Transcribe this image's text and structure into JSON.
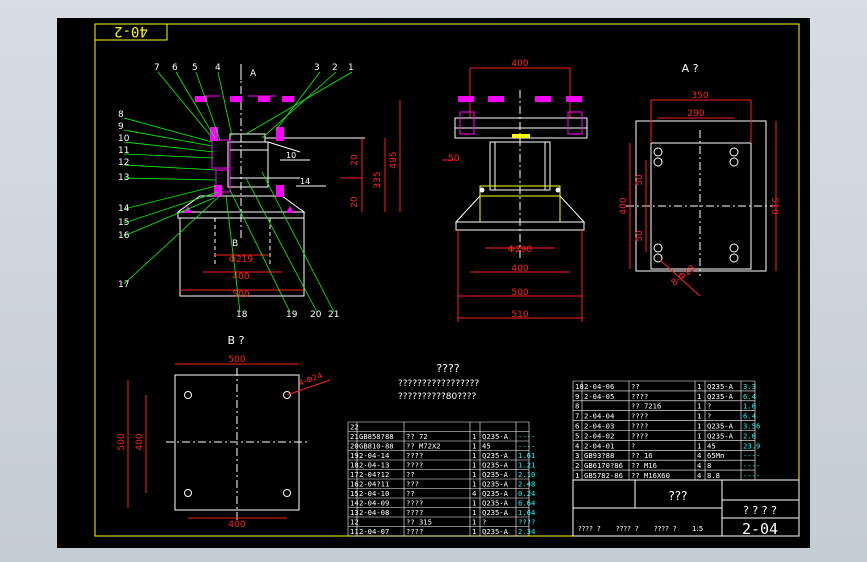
{
  "sheet": {
    "code_box": "40-2",
    "drawing_number": "2-04",
    "title_center": "???",
    "title_right": "? ? ? ?",
    "notes_title": "????",
    "notes": [
      "?????????????????",
      "??????????80????"
    ]
  },
  "front_view": {
    "section_label_top": "A",
    "section_label_bottom": "B",
    "part_numbers_top": [
      "7",
      "6",
      "5",
      "4",
      "3",
      "2",
      "1"
    ],
    "part_numbers_left": [
      "8",
      "9",
      "10",
      "11",
      "12",
      "13",
      "14",
      "15",
      "16",
      "17"
    ],
    "part_numbers_bottom": [
      "18",
      "19",
      "20",
      "21"
    ],
    "angle_labels": [
      "10",
      "14"
    ],
    "dims": {
      "d20a": "20",
      "d335": "335",
      "d495": "495",
      "d20b": "20",
      "phi219": "Φ219",
      "w400": "400",
      "w500": "500"
    }
  },
  "side_view": {
    "dims": {
      "top": "400",
      "left50": "50",
      "phi290": "Φ290",
      "w400": "400",
      "w500": "500",
      "w510": "510"
    }
  },
  "view_a": {
    "title": "A  ?",
    "dims": {
      "w350": "350",
      "w290": "290",
      "h400": "400",
      "h510": "510",
      "v50a": "50",
      "v50b": "50",
      "holes": "8-Φ18"
    }
  },
  "view_b": {
    "title": "B  ?",
    "dims": {
      "w500": "500",
      "h500": "500",
      "h400": "400",
      "w400": "400",
      "holes": "4-Φ24"
    }
  },
  "bom_left": {
    "rows": [
      [
        "22",
        "",
        "",
        "",
        "",
        ""
      ],
      [
        "21",
        "GB858?88",
        "??  72",
        "1",
        "Q235-A",
        "----"
      ],
      [
        "20",
        "GB810-88",
        "?? M72X2",
        "1",
        "45",
        "----"
      ],
      [
        "19",
        "2-04-14",
        "????",
        "1",
        "Q235-A",
        "1.61"
      ],
      [
        "18",
        "2-04-13",
        "????",
        "1",
        "Q235-A",
        "1.21"
      ],
      [
        "17",
        "2-04?12",
        "??",
        "1",
        "Q235-A",
        "2.10"
      ],
      [
        "16",
        "2-04?11",
        "???",
        "1",
        "Q235-A",
        "2.48"
      ],
      [
        "15",
        "2-04-10",
        "??",
        "4",
        "Q235-A",
        "0.24"
      ],
      [
        "14",
        "2-04-09",
        "????",
        "1",
        "Q235-A",
        "6.64"
      ],
      [
        "13",
        "2-04-08",
        "????",
        "1",
        "Q235-A",
        "1.64"
      ],
      [
        "12",
        "",
        "?? 315",
        "1",
        "?",
        "????"
      ],
      [
        "11",
        "2-04-07",
        "????",
        "1",
        "Q235-A",
        "2.34"
      ]
    ]
  },
  "bom_right": {
    "rows": [
      [
        "10",
        "2-04-06",
        "??",
        "1",
        "Q235-A",
        "3.3"
      ],
      [
        "9",
        "2-04-05",
        "????",
        "1",
        "Q235-A",
        "6.4"
      ],
      [
        "8",
        "",
        "?? 7216",
        "1",
        "?",
        "1.6"
      ],
      [
        "7",
        "2-04-04",
        "????",
        "1",
        "?",
        "6.4"
      ],
      [
        "6",
        "2-04-03",
        "????",
        "1",
        "Q235-A",
        "3.56"
      ],
      [
        "5",
        "2-04-02",
        "????",
        "1",
        "Q235-A",
        "2.6"
      ],
      [
        "4",
        "2-04-01",
        "?",
        "1",
        "45",
        "23.9"
      ],
      [
        "3",
        "GB93?88",
        "?? 16",
        "4",
        "65Mn",
        "----"
      ],
      [
        "2",
        "GB6170?86",
        "?? M16",
        "4",
        "8",
        "----"
      ],
      [
        "1",
        "GB5782-86",
        "?? M16X60",
        "4",
        "8.8",
        "----"
      ]
    ],
    "footer": [
      "????",
      "?",
      "????",
      "?",
      "????",
      "?",
      "1:5"
    ]
  },
  "colors": {
    "background": "#000000",
    "frame": "#ffff00",
    "lines": "#ffffff",
    "dims": "#ff2020",
    "bolts": "#ff00ff",
    "leaders": "#00ff00",
    "cyan": "#00ffff"
  }
}
